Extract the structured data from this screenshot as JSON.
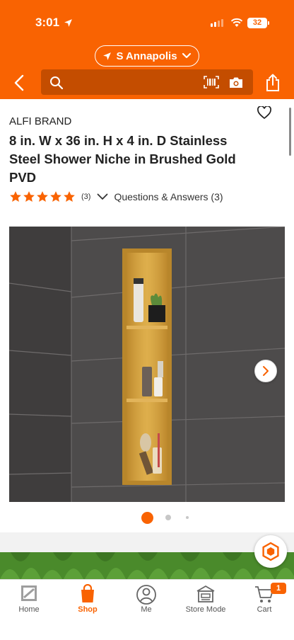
{
  "status_bar": {
    "time": "3:01",
    "battery": "32"
  },
  "header": {
    "store": "S Annapolis",
    "search": {
      "placeholder": ""
    }
  },
  "product": {
    "brand": "ALFI BRAND",
    "title": "8 in. W x 36 in. H x 4 in. D Stainless Steel Shower Niche in Brushed Gold PVD",
    "rating": 5,
    "rating_count": "(3)",
    "qa_label": "Questions & Answers (3)"
  },
  "gallery": {
    "current_index": 0,
    "dot_count": 3
  },
  "tab_bar": {
    "tabs": [
      {
        "label": "Home",
        "icon": "home-depot-logo-icon"
      },
      {
        "label": "Shop",
        "icon": "shop-bag-icon"
      },
      {
        "label": "Me",
        "icon": "person-icon"
      },
      {
        "label": "Store Mode",
        "icon": "store-icon"
      },
      {
        "label": "Cart",
        "icon": "cart-icon"
      }
    ],
    "active": "Shop",
    "cart_count": "1"
  },
  "colors": {
    "brand": "#f96302",
    "accent_dark": "#c44d00",
    "star": "#f96302",
    "banner_green": "#4a8a2b"
  }
}
